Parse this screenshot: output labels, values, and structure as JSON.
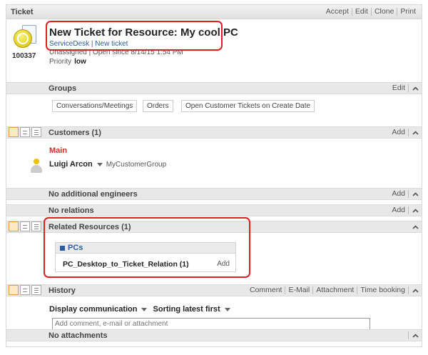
{
  "header": {
    "title": "Ticket",
    "actions": [
      "Accept",
      "Edit",
      "Clone",
      "Print"
    ]
  },
  "ticket": {
    "id": "100337",
    "title": "New Ticket for Resource: My cool PC",
    "meta_line1": "ServiceDesk | New ticket",
    "meta_line2": "Unassigned | Open since 8/14/15 1:54 PM",
    "priority_label": "Priority",
    "priority_value": "low"
  },
  "groups": {
    "label": "Groups",
    "action": "Edit",
    "tags": [
      "Conversations/Meetings",
      "Orders",
      "Open Customer Tickets on Create Date"
    ]
  },
  "customers": {
    "label": "Customers (1)",
    "action": "Add",
    "main_label": "Main",
    "customer_name": "Luigi Arcon",
    "customer_group": "MyCustomerGroup"
  },
  "engineers": {
    "label": "No additional engineers",
    "action": "Add"
  },
  "relations": {
    "label": "No relations",
    "action": "Add"
  },
  "related_resources": {
    "label": "Related Resources (1)",
    "box_title": "PCs",
    "row_label": "PC_Desktop_to_Ticket_Relation (1)",
    "row_action": "Add"
  },
  "history": {
    "label": "History",
    "actions": [
      "Comment",
      "E-Mail",
      "Attachment",
      "Time booking"
    ],
    "display_option": "Display communication",
    "sort_option": "Sorting latest first",
    "input_placeholder": "Add comment, e-mail or attachment"
  },
  "attachments": {
    "label": "No attachments"
  },
  "colors": {
    "highlight": "#e02020",
    "main_label": "#c0392b",
    "link_blue": "#2a5d9f"
  }
}
